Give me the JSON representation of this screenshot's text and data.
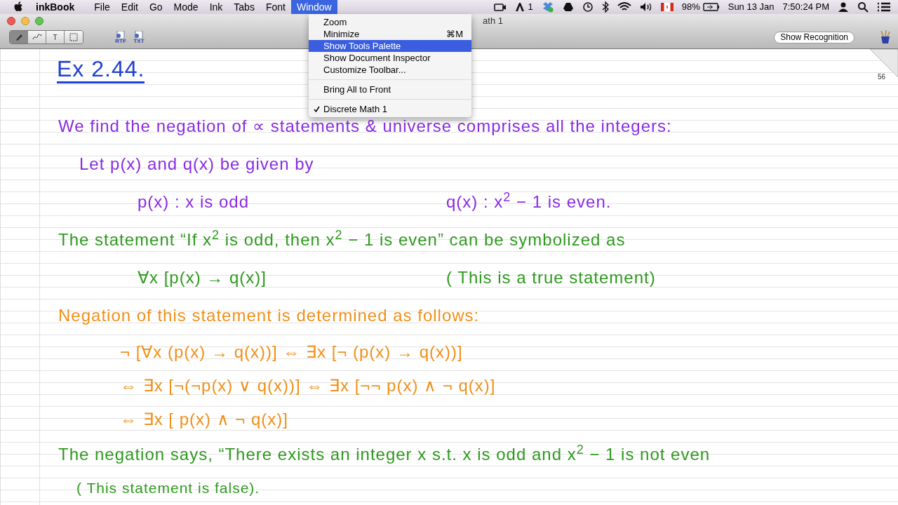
{
  "menu_bar": {
    "app_name": "inkBook",
    "menus": [
      {
        "label": "File",
        "selected": false
      },
      {
        "label": "Edit",
        "selected": false
      },
      {
        "label": "Go",
        "selected": false
      },
      {
        "label": "Mode",
        "selected": false
      },
      {
        "label": "Ink",
        "selected": false
      },
      {
        "label": "Tabs",
        "selected": false
      },
      {
        "label": "Font",
        "selected": false
      },
      {
        "label": "Window",
        "selected": true
      }
    ],
    "status": {
      "notification_count": "1",
      "battery": "98%",
      "date": "Sun 13 Jan",
      "time": "7:50:24 PM"
    }
  },
  "window": {
    "title": "ath 1",
    "tools": [
      {
        "kind": "pen",
        "selected": true
      },
      {
        "kind": "eraser",
        "selected": false
      },
      {
        "kind": "text",
        "label": "T",
        "selected": false
      },
      {
        "kind": "select",
        "selected": false
      }
    ],
    "exports": [
      {
        "label": "RTF"
      },
      {
        "label": "TXT"
      }
    ],
    "recognition_button": "Show Recognition"
  },
  "window_menu": [
    {
      "kind": "item",
      "label": "Zoom",
      "selected": false,
      "checked": false
    },
    {
      "kind": "item",
      "label": "Minimize",
      "shortcut": "⌘M",
      "selected": false,
      "checked": false
    },
    {
      "kind": "item",
      "label": "Show Tools Palette",
      "selected": true,
      "checked": false
    },
    {
      "kind": "item",
      "label": "Show Document Inspector",
      "selected": false,
      "checked": false
    },
    {
      "kind": "item",
      "label": "Customize Toolbar...",
      "selected": false,
      "checked": false
    },
    {
      "kind": "separator"
    },
    {
      "kind": "item",
      "label": "Bring All to Front",
      "selected": false,
      "checked": false
    },
    {
      "kind": "separator"
    },
    {
      "kind": "item",
      "label": "Discrete Math 1",
      "selected": false,
      "checked": true
    }
  ],
  "page": {
    "page_number": "56",
    "lines": [
      {
        "kind": "heading",
        "color": "#1f3fd6",
        "parts": [
          "Ex 2.44."
        ]
      },
      {
        "kind": "text",
        "color": "#8a2be2",
        "parts": [
          "We find the negation of ∝ statements & universe comprises all the integers:"
        ]
      },
      {
        "kind": "sub",
        "color": "#8a2be2",
        "parts": [
          "Let p(x) and q(x) be given by"
        ]
      },
      {
        "kind": "pair",
        "color": "#8a2be2",
        "parts": [
          "p(x) : x is odd",
          "q(x) : x$^{2}$ − 1 is even."
        ]
      },
      {
        "kind": "text",
        "color": "#2e9a1e",
        "parts": [
          "The statement “If x$^{2}$ is odd, then x$^{2}$ − 1 is even” can be symbolized as"
        ]
      },
      {
        "kind": "pair",
        "color": "#2e9a1e",
        "parts": [
          "∀x [p(x) → q(x)]",
          "( This is a true statement)"
        ]
      },
      {
        "kind": "text",
        "color": "#f0901a",
        "parts": [
          "Negation of this statement is determined as follows:"
        ]
      },
      {
        "kind": "formula",
        "color": "#f0901a",
        "parts": [
          "¬ [∀x (p(x) → q(x))] ⇔ ∃x [¬ (p(x) → q(x))]"
        ]
      },
      {
        "kind": "formula",
        "color": "#f0901a",
        "parts": [
          "⇔ ∃x [¬(¬p(x) ∨ q(x))] ⇔ ∃x [¬¬ p(x) ∧ ¬ q(x)]"
        ]
      },
      {
        "kind": "formula",
        "color": "#f0901a",
        "parts": [
          "⇔ ∃x [ p(x) ∧ ¬ q(x)]"
        ]
      },
      {
        "kind": "text",
        "color": "#2e9a1e",
        "parts": [
          "The negation says, “There exists an integer x s.t. x is odd and x$^{2}$ − 1 is not even"
        ]
      },
      {
        "kind": "note",
        "color": "#2e9a1e",
        "parts": [
          "( This statement is false)."
        ]
      }
    ]
  }
}
